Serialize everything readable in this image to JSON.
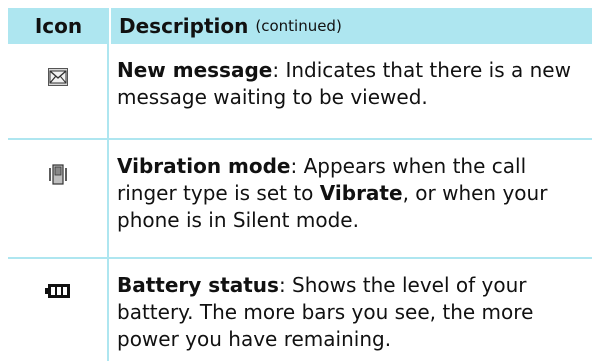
{
  "header": {
    "icon_col": "Icon",
    "desc_col": "Description",
    "desc_sub": "(continued)"
  },
  "rows": [
    {
      "icon": "envelope-icon",
      "title": "New message",
      "text": ": Indicates that there is a new message waiting to be viewed."
    },
    {
      "icon": "vibration-icon",
      "title": "Vibration mode",
      "text_before": ": Appears when the call ringer type is set to ",
      "bold_word": "Vibrate",
      "text_after": ", or when your phone is in Silent mode."
    },
    {
      "icon": "battery-icon",
      "title": "Battery status",
      "text": ": Shows the level of your battery. The more bars you see, the more power you have remaining."
    }
  ],
  "colors": {
    "header_bg": "#aee6f0",
    "rule": "#aee6f0"
  }
}
